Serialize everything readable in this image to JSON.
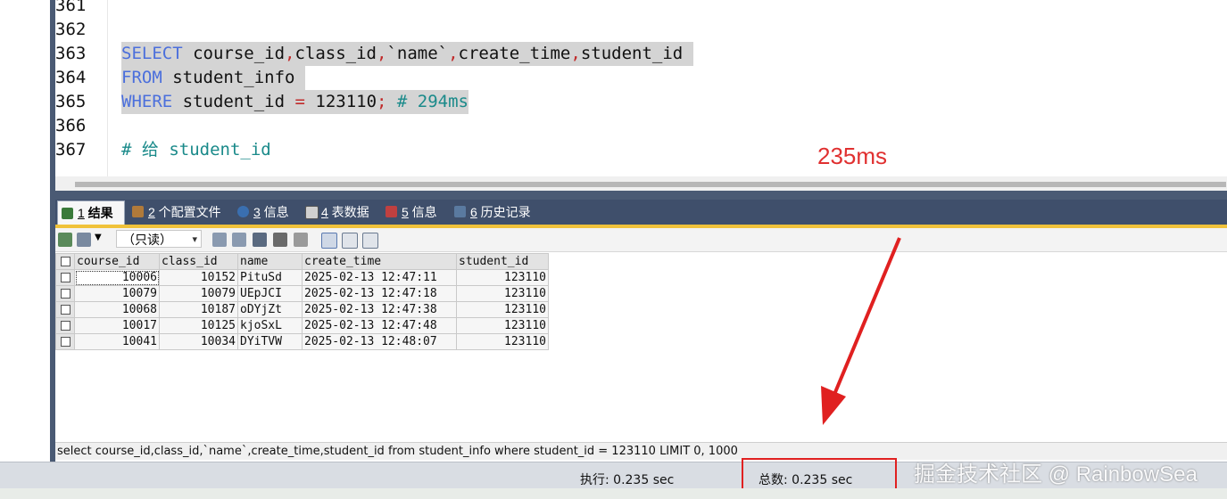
{
  "editor": {
    "lines": [
      {
        "num": "361"
      },
      {
        "num": "362"
      },
      {
        "num": "363"
      },
      {
        "num": "364"
      },
      {
        "num": "365"
      },
      {
        "num": "366"
      },
      {
        "num": "367"
      }
    ],
    "line363": {
      "kw": "SELECT",
      "rest1": " course_id",
      "c1": ",",
      "rest2": "class_id",
      "c2": ",",
      "rest3": "`name`",
      "c3": ",",
      "rest4": "create_time",
      "c4": ",",
      "rest5": "student_id "
    },
    "line364": {
      "kw": "FROM",
      "rest": " student_info "
    },
    "line365": {
      "kw": "WHERE",
      "rest": " student_id ",
      "op": "=",
      "num": " 123110",
      "semi": ";",
      "comment": " # 294ms"
    },
    "line367": {
      "comment": "# 给 student_id"
    }
  },
  "annotation": "235ms",
  "tabs": [
    {
      "num": "1",
      "label": " 结果",
      "active": true,
      "color": "#3a7a3a"
    },
    {
      "num": "2",
      "label": " 个配置文件",
      "active": false,
      "color": "#b07a3a"
    },
    {
      "num": "3",
      "label": " 信息",
      "active": false,
      "color": "#3a6fb0"
    },
    {
      "num": "4",
      "label": " 表数据",
      "active": false,
      "color": "#6a6a6a"
    },
    {
      "num": "5",
      "label": " 信息",
      "active": false,
      "color": "#c04040"
    },
    {
      "num": "6",
      "label": " 历史记录",
      "active": false,
      "color": "#5a7aa0"
    }
  ],
  "toolbar": {
    "readonly": "（只读）"
  },
  "grid": {
    "columns": [
      "course_id",
      "class_id",
      "name",
      "create_time",
      "student_id"
    ],
    "rows": [
      [
        "10006",
        "10152",
        "PituSd",
        "2025-02-13 12:47:11",
        "123110"
      ],
      [
        "10079",
        "10079",
        "UEpJCI",
        "2025-02-13 12:47:18",
        "123110"
      ],
      [
        "10068",
        "10187",
        "oDYjZt",
        "2025-02-13 12:47:38",
        "123110"
      ],
      [
        "10017",
        "10125",
        "kjoSxL",
        "2025-02-13 12:47:48",
        "123110"
      ],
      [
        "10041",
        "10034",
        "DYiTVW",
        "2025-02-13 12:48:07",
        "123110"
      ]
    ]
  },
  "sql_status": "select course_id,class_id,`name`,create_time,student_id from student_info where student_id = 123110 LIMIT 0, 1000",
  "statusbar": {
    "exec": "执行: 0.235 sec",
    "total": "总数: 0.235 sec"
  },
  "watermark": "掘金技术社区 @ RainbowSea",
  "colors": {
    "annotation": "#e03030",
    "keyword": "#4b6fdc",
    "comment": "#1a8a8a",
    "operator": "#c02a2a",
    "tab_bar": "#3f4f6b",
    "tab_underline": "#f0c23a"
  }
}
